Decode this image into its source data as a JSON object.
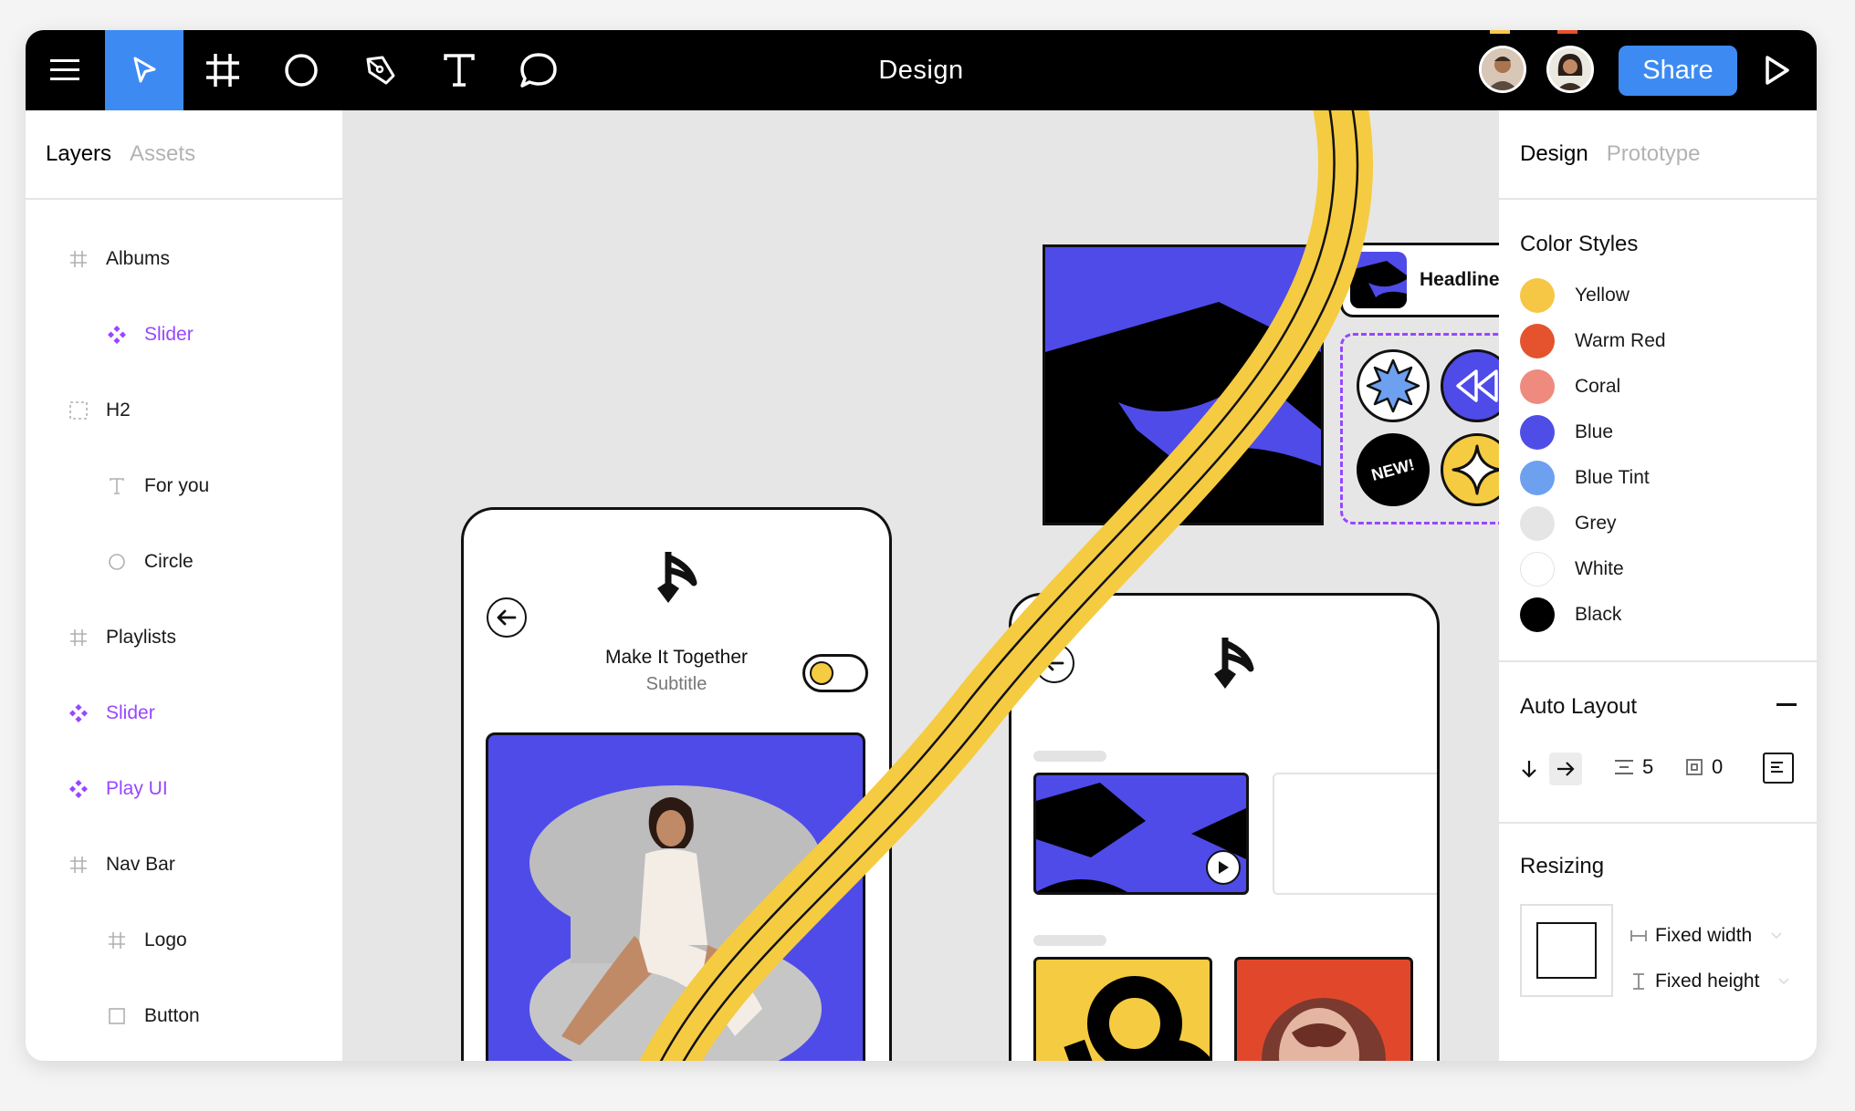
{
  "toolbar": {
    "title": "Design",
    "share_label": "Share",
    "tools": [
      "menu-icon",
      "move-tool-icon",
      "frame-tool-icon",
      "ellipse-tool-icon",
      "pen-tool-icon",
      "text-tool-icon",
      "comment-tool-icon"
    ],
    "active_tool": "move-tool-icon",
    "accent": "#3d8bf2"
  },
  "left_panel": {
    "tabs": {
      "layers": "Layers",
      "assets": "Assets"
    },
    "layers": [
      {
        "label": "Albums",
        "icon": "frame-icon"
      },
      {
        "label": "Slider",
        "icon": "component-icon"
      },
      {
        "label": "H2",
        "icon": "group-icon"
      },
      {
        "label": "For you",
        "icon": "text-icon"
      },
      {
        "label": "Circle",
        "icon": "ellipse-icon"
      },
      {
        "label": "Playlists",
        "icon": "frame-icon"
      },
      {
        "label": "Slider",
        "icon": "component-icon"
      },
      {
        "label": "Play UI",
        "icon": "component-icon"
      },
      {
        "label": "Nav Bar",
        "icon": "frame-icon"
      },
      {
        "label": "Logo",
        "icon": "frame-icon"
      },
      {
        "label": "Button",
        "icon": "rectangle-icon"
      }
    ]
  },
  "right_panel": {
    "tabs": {
      "design": "Design",
      "prototype": "Prototype"
    },
    "color_styles_title": "Color Styles",
    "colors": [
      {
        "name": "Yellow",
        "hex": "#f6c744"
      },
      {
        "name": "Warm Red",
        "hex": "#e4532d"
      },
      {
        "name": "Coral",
        "hex": "#ef8a7e"
      },
      {
        "name": "Blue",
        "hex": "#4e4ee6"
      },
      {
        "name": "Blue Tint",
        "hex": "#6ea0f0"
      },
      {
        "name": "Grey",
        "hex": "#e5e5e5"
      },
      {
        "name": "White",
        "hex": "#ffffff"
      },
      {
        "name": "Black",
        "hex": "#000000"
      }
    ],
    "auto_layout": {
      "title": "Auto Layout",
      "spacing": "5",
      "padding": "0"
    },
    "resizing": {
      "title": "Resizing",
      "width_label": "Fixed width",
      "height_label": "Fixed height"
    }
  },
  "canvas": {
    "headline_label": "Headline",
    "badge_label": "NEW!",
    "phone1": {
      "title": "Make It Together",
      "subtitle": "Subtitle"
    },
    "colors": {
      "purple": "#4f4be8",
      "yellow": "#f5cb41",
      "red": "#e1482b",
      "component": "#9747ff"
    }
  }
}
